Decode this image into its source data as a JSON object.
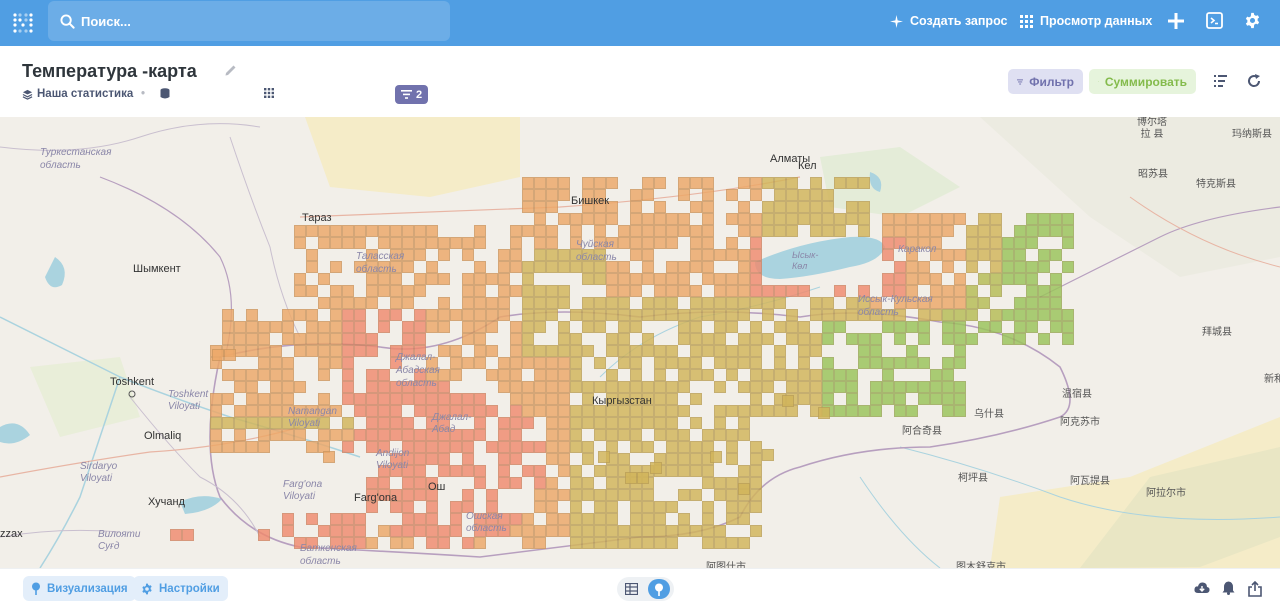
{
  "nav": {
    "search_placeholder": "Поиск...",
    "new_question": "Создать запрос",
    "browse_data": "Просмотр данных"
  },
  "header": {
    "title": "Температура -карта",
    "collection": "Наша статистика",
    "filter_count": "2",
    "filter_button": "Фильтр",
    "summarize_button": "Суммировать"
  },
  "map": {
    "labels": {
      "almaty": "Алматы",
      "bishkek": "Бишкек",
      "taraz": "Тараз",
      "shymkent": "Шымкент",
      "toshkent": "Toshkent",
      "toshkent_viloyati": "Toshkent Viloyati",
      "turkestan_oblast": "Туркестанская область",
      "talas_oblast": "Таласская область",
      "jalalabad_oblast": "Джалал-Абадская область",
      "jalalabad": "Джалал-Абад",
      "kyrgyzstan": "Кыргызстан",
      "issykkul_oblast": "Иссык-Кульская область",
      "issykkul_lake": "Ысык-Көл",
      "karakol": "Каракол",
      "chui_oblast": "Чуйская область",
      "namangan": "Namangan Viloyati",
      "andijon": "Andijon Viloyati",
      "fargona_v": "Farg'ona Viloyati",
      "fargona": "Farg'ona",
      "osh": "Ош",
      "osh_oblast": "Ошская область",
      "batken": "Баткенская область",
      "olmaliq": "Olmaliq",
      "sirdaryo": "Sirdaryo Viloyati",
      "xuchand": "Хучанд",
      "viloyati_sugd": "Вилояти Суғд",
      "zzax": "zzax",
      "kel": "Кел",
      "cn_1": "博尔塔拉 县",
      "cn_2": "玛纳斯县",
      "cn_3": "昭苏县",
      "cn_4": "特克斯县",
      "cn_5": "拜城县",
      "cn_6": "温宿县",
      "cn_7": "阿克苏市",
      "cn_8": "乌什县",
      "cn_9": "阿合奇县",
      "cn_10": "柯坪县",
      "cn_11": "阿瓦提县",
      "cn_12": "阿拉尔市",
      "cn_13": "新和",
      "cn_14": "阿图什市",
      "cn_15": "图木舒克市"
    },
    "grid_colors": {
      "hot": "#f08a6e",
      "warm": "#eda868",
      "mid": "#d2b55a",
      "cool": "#b6bd55",
      "green": "#9ac45a"
    }
  },
  "footer": {
    "visualization": "Визуализация",
    "settings": "Настройки"
  }
}
